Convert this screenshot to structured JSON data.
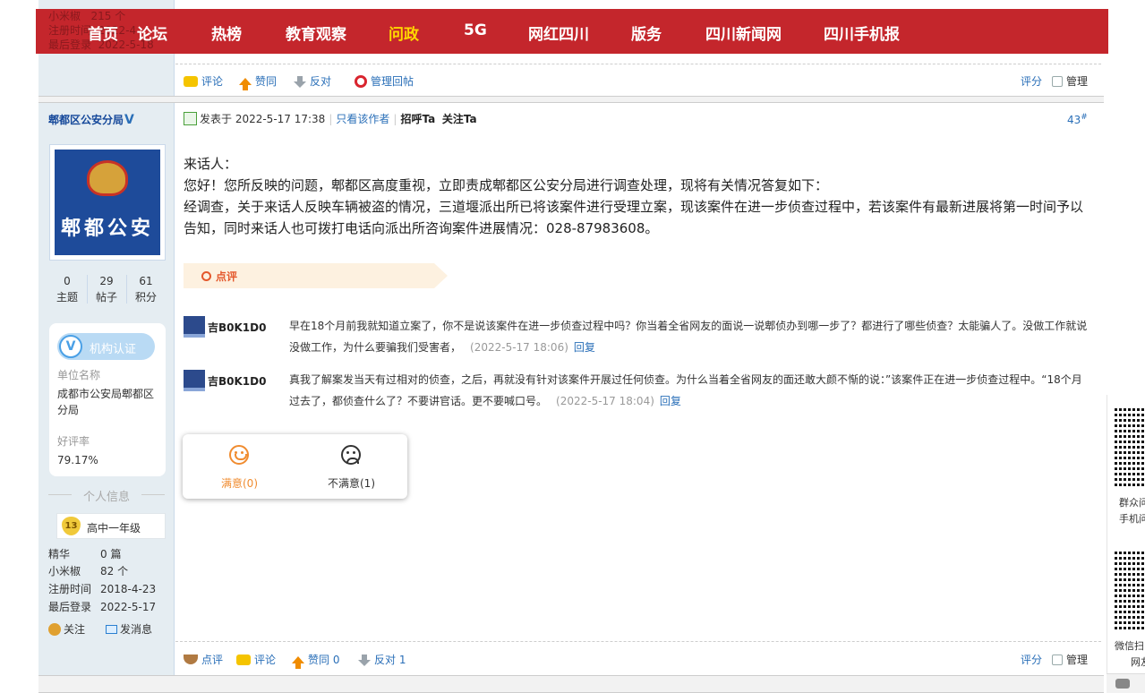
{
  "nav": {
    "ghost_rows": [
      {
        "k": "小米椒",
        "v": "215 个"
      },
      {
        "k": "注册时间",
        "v": "2022-4"
      },
      {
        "k": "最后登录",
        "v": "2022-5-18"
      }
    ],
    "items": [
      "首页",
      "论坛",
      "热榜",
      "教育观察",
      "问政",
      "5G",
      "网红四川",
      "版务",
      "四川新闻网",
      "四川手机报"
    ],
    "active": "问政"
  },
  "prev_actions": {
    "comment": "评论",
    "like": "赞同",
    "dislike": "反对",
    "manage": "管理回帖",
    "rate": "评分",
    "admin": "管理"
  },
  "user": {
    "name": "郫都区公安分局",
    "verified_mark": "V",
    "avatar_text": "郫都公安",
    "stats": [
      {
        "num": "0",
        "label": "主题"
      },
      {
        "num": "29",
        "label": "帖子"
      },
      {
        "num": "61",
        "label": "积分"
      }
    ],
    "org": {
      "badge_icon": "V",
      "badge_label": "机构认证",
      "unit_label": "单位名称",
      "unit_value": "成都市公安局郫都区分局",
      "rating_label": "好评率",
      "rating_value": "79.17%"
    },
    "section_title": "个人信息",
    "level_num": "13",
    "level_name": "高中一年级",
    "profile": [
      {
        "k": "精华",
        "v": "0 篇"
      },
      {
        "k": "小米椒",
        "v": "82 个"
      },
      {
        "k": "注册时间",
        "v": "2018-4-23"
      },
      {
        "k": "最后登录",
        "v": "2022-5-17"
      }
    ],
    "follow": "关注",
    "message": "发消息"
  },
  "post": {
    "posted": "发表于 2022-5-17 17:38",
    "only_author": "只看该作者",
    "greet": "招呼Ta",
    "follow_ta": "关注Ta",
    "floor": "43",
    "floor_mark": "#",
    "lines": [
      "来话人：",
      "您好！您所反映的问题，郫都区高度重视，立即责成郫都区公安分局进行调查处理，现将有关情况答复如下：",
      "经调查，关于来话人反映车辆被盗的情况，三道堰派出所已将该案件进行受理立案，现该案件在进一步侦查过程中，若该案件有最新进展将第一时间予以告知，同时来话人也可拨打电话向派出所咨询案件进展情况：028-87983608。"
    ]
  },
  "comments_title": "点评",
  "comments": [
    {
      "user": "吉B0K1D0",
      "text": "早在18个月前我就知道立案了，你不是说该案件在进一步侦查过程中吗？你当着全省网友的面说一说郫侦办到哪一步了？都进行了哪些侦查？太能骗人了。没做工作就说没做工作，为什么要骗我们受害者，",
      "time": "(2022-5-17 18:06)",
      "reply": "回复"
    },
    {
      "user": "吉B0K1D0",
      "text": "真我了解案发当天有过相对的侦查，之后，再就没有针对该案件开展过任何侦查。为什么当着全省网友的面还敢大颜不惭的说：”该案件正在进一步侦查过程中。“18个月过去了，都侦查什么了？不要讲官话。更不要喊口号。",
      "time": "(2022-5-17 18:04)",
      "reply": "回复"
    }
  ],
  "rating": {
    "satisfied": "满意(0)",
    "unsatisfied": "不满意(1)"
  },
  "post_actions": {
    "review": "点评",
    "comment": "评论",
    "like": "赞同 0",
    "dislike": "反对 1",
    "rate": "评分",
    "admin": "管理"
  },
  "sidebar_float": {
    "qr1": [
      "群众问",
      "手机问"
    ],
    "qr2": [
      "微信扫",
      "网友"
    ]
  },
  "colors": {
    "nav_bg": "#c4262c",
    "nav_active": "#ffd700",
    "link": "#2a6fb8",
    "side_bg": "#e5edf2"
  }
}
